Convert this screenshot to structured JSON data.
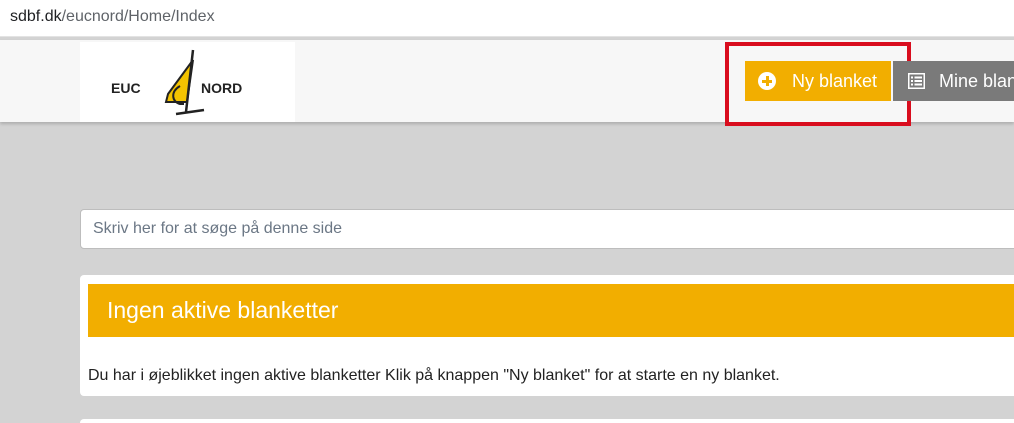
{
  "browser": {
    "url_host": "sdbf.dk",
    "url_path": "/eucnord/Home/Index"
  },
  "navbar": {
    "logo": {
      "text_left": "EUC",
      "text_right": "NORD"
    },
    "new_button_label": "Ny blanket",
    "mine_button_label": "Mine blanketter"
  },
  "search": {
    "placeholder": "Skriv her for at søge på denne side"
  },
  "card": {
    "title": "Ingen aktive blanketter",
    "message": "Du har i øjeblikket ingen aktive blanketter Klik på knappen \"Ny blanket\" for at starte en ny blanket."
  },
  "colors": {
    "accent": "#f2ae00",
    "secondary_button": "#7a7a7a",
    "highlight_border": "#d90d1e",
    "page_background": "#d3d3d3"
  }
}
